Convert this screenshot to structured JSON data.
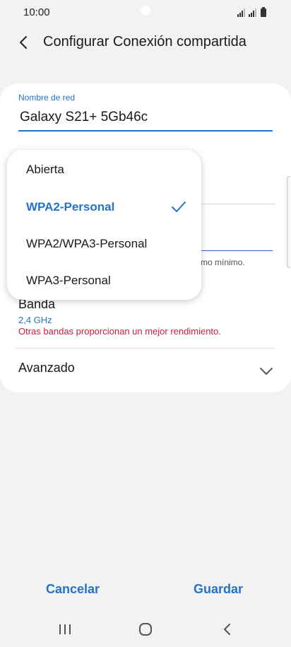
{
  "status_bar": {
    "time": "10:00"
  },
  "header": {
    "title": "Configurar Conexión compartida"
  },
  "network_name": {
    "label": "Nombre de red",
    "value": "Galaxy S21+ 5Gb46c"
  },
  "partial_hint": "mo mínimo.",
  "band": {
    "title": "Banda",
    "value": "2,4 GHz",
    "warning": "Otras bandas proporcionan un mejor rendimiento."
  },
  "advanced": {
    "label": "Avanzado"
  },
  "security_dropdown": {
    "options": [
      {
        "label": "Abierta",
        "selected": false
      },
      {
        "label": "WPA2-Personal",
        "selected": true
      },
      {
        "label": "WPA2/WPA3-Personal",
        "selected": false
      },
      {
        "label": "WPA3-Personal",
        "selected": false
      }
    ]
  },
  "footer": {
    "cancel_label": "Cancelar",
    "save_label": "Guardar"
  },
  "icons": {
    "back": "back-icon",
    "check": "check-icon",
    "chevron": "chevron-down-icon",
    "nav_recents": "recents-icon",
    "nav_home": "home-icon",
    "nav_back": "nav-back-icon",
    "signal": "signal-icon",
    "battery": "battery-icon"
  },
  "colors": {
    "accent": "#2473c9",
    "warning": "#c41e3a",
    "background": "#f2f2f2",
    "card": "#ffffff"
  }
}
